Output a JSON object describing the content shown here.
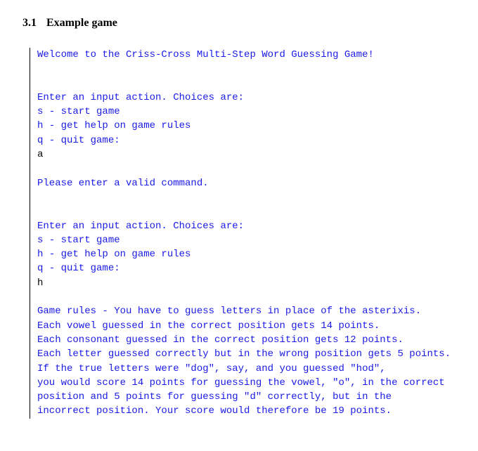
{
  "heading": {
    "number": "3.1",
    "title": "Example game"
  },
  "terminal": {
    "l01": "Welcome to the Criss-Cross Multi-Step Word Guessing Game!",
    "l02": "",
    "l03": "",
    "l04": "Enter an input action. Choices are:",
    "l05": "s - start game",
    "l06": "h - get help on game rules",
    "l07": "q - quit game:",
    "l08": "a",
    "l09": "",
    "l10": "Please enter a valid command.",
    "l11": "",
    "l12": "",
    "l13": "Enter an input action. Choices are:",
    "l14": "s - start game",
    "l15": "h - get help on game rules",
    "l16": "q - quit game:",
    "l17": "h",
    "l18": "",
    "l19": "Game rules - You have to guess letters in place of the asterixis.",
    "l20": "Each vowel guessed in the correct position gets 14 points.",
    "l21": "Each consonant guessed in the correct position gets 12 points.",
    "l22": "Each letter guessed correctly but in the wrong position gets 5 points.",
    "l23": "If the true letters were \"dog\", say, and you guessed \"hod\",",
    "l24": "you would score 14 points for guessing the vowel, \"o\", in the correct",
    "l25": "position and 5 points for guessing \"d\" correctly, but in the",
    "l26": "incorrect position. Your score would therefore be 19 points."
  }
}
